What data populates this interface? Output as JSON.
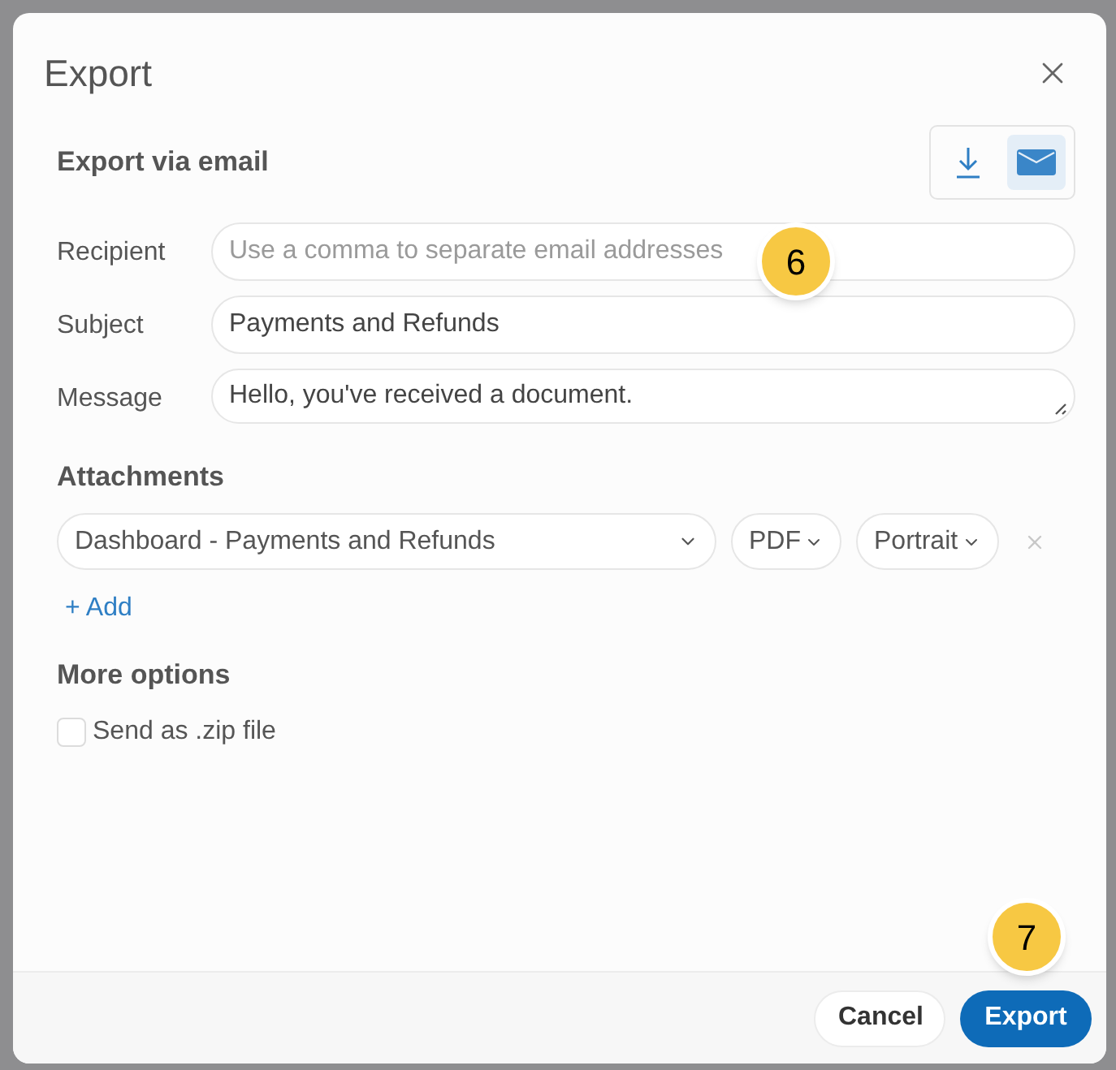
{
  "dialog": {
    "title": "Export",
    "section_title": "Export via email",
    "modes": [
      {
        "kind": "download",
        "selected": false
      },
      {
        "kind": "email",
        "selected": true
      }
    ],
    "fields": [
      {
        "label": "Recipient",
        "placeholder": "Use a comma to separate email addresses",
        "kind": "input"
      },
      {
        "label": "Subject",
        "value": "Payments and Refunds",
        "kind": "input"
      },
      {
        "label": "Message",
        "value": "Hello, you've received a document.",
        "kind": "textarea"
      }
    ],
    "attachments_title": "Attachments",
    "attachments": [
      {
        "report": "Dashboard - Payments and Refunds",
        "format": "PDF",
        "orientation": "Portrait"
      }
    ],
    "add_label": "+ Add",
    "more_options_title": "More options",
    "options": [
      {
        "label": "Send as .zip file",
        "checked": false
      }
    ],
    "buttons": [
      {
        "label": "Cancel",
        "kind": "secondary"
      },
      {
        "label": "Export",
        "kind": "primary"
      }
    ]
  },
  "callouts": [
    {
      "label": "6",
      "kind": "recipient"
    },
    {
      "label": "7",
      "kind": "export"
    }
  ]
}
